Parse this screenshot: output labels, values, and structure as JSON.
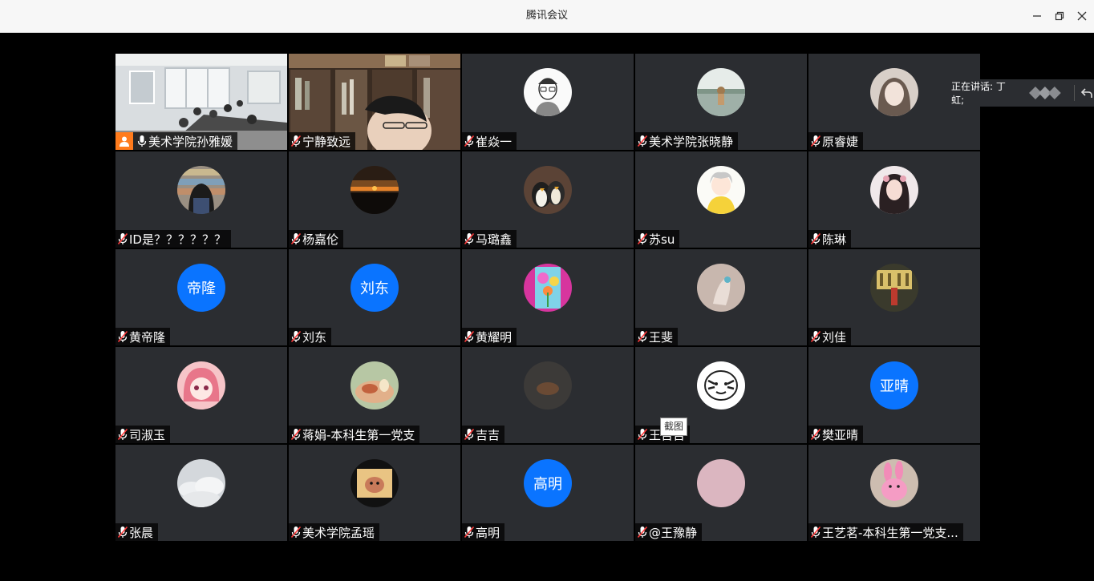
{
  "window": {
    "title": "腾讯会议"
  },
  "speaking_bar": {
    "label": "正在讲话: 丁虹;"
  },
  "tooltip": "截图",
  "participants": [
    {
      "name": "美术学院孙雅媛",
      "avatar": "video-classroom",
      "host": true,
      "mic": "on"
    },
    {
      "name": "宁静致远",
      "avatar": "video-bookshelf",
      "mic": "muted"
    },
    {
      "name": "崔焱一",
      "avatar": "avatar-sketch",
      "mic": "muted"
    },
    {
      "name": "美术学院张晓静",
      "avatar": "avatar-landscape",
      "mic": "muted"
    },
    {
      "name": "原睿婕",
      "avatar": "avatar-portrait-pale",
      "mic": "muted"
    },
    {
      "name": "ID是？？？？？？",
      "avatar": "avatar-library",
      "mic": "muted"
    },
    {
      "name": "杨嘉伦",
      "avatar": "avatar-sunset",
      "mic": "muted"
    },
    {
      "name": "马璐鑫",
      "avatar": "avatar-penguins",
      "mic": "muted"
    },
    {
      "name": "苏su",
      "avatar": "avatar-anime-yellow",
      "mic": "muted"
    },
    {
      "name": "陈琳",
      "avatar": "avatar-portrait-girl",
      "mic": "muted"
    },
    {
      "name": "黄帝隆",
      "avatar_text": "帝隆",
      "mic": "muted"
    },
    {
      "name": "刘东",
      "avatar_text": "刘东",
      "mic": "muted"
    },
    {
      "name": "黄耀明",
      "avatar": "avatar-flowers",
      "mic": "muted"
    },
    {
      "name": "王斐",
      "avatar": "avatar-drawing-beige",
      "mic": "muted"
    },
    {
      "name": "刘佳",
      "avatar": "avatar-city-photo",
      "mic": "muted"
    },
    {
      "name": "司淑玉",
      "avatar": "avatar-anime-pink",
      "mic": "muted"
    },
    {
      "name": "蒋娟-本科生第一党支",
      "avatar": "avatar-illustration-warm",
      "mic": "muted"
    },
    {
      "name": "吉吉",
      "avatar": "avatar-dark-photo",
      "mic": "muted"
    },
    {
      "name": "王吉吉",
      "avatar": "avatar-cartoon-tiger",
      "mic": "muted"
    },
    {
      "name": "樊亚晴",
      "avatar_text": "亚晴",
      "mic": "muted"
    },
    {
      "name": "张晨",
      "avatar": "avatar-clouds",
      "mic": "muted"
    },
    {
      "name": "美术学院孟瑶",
      "avatar": "avatar-hamster",
      "mic": "muted"
    },
    {
      "name": "高明",
      "avatar_text": "高明",
      "mic": "muted"
    },
    {
      "name": "@王豫静",
      "avatar": "avatar-pink-blank",
      "mic": "muted"
    },
    {
      "name": "王艺茗-本科生第一党支...",
      "avatar": "avatar-pink-bunny",
      "mic": "muted"
    }
  ]
}
